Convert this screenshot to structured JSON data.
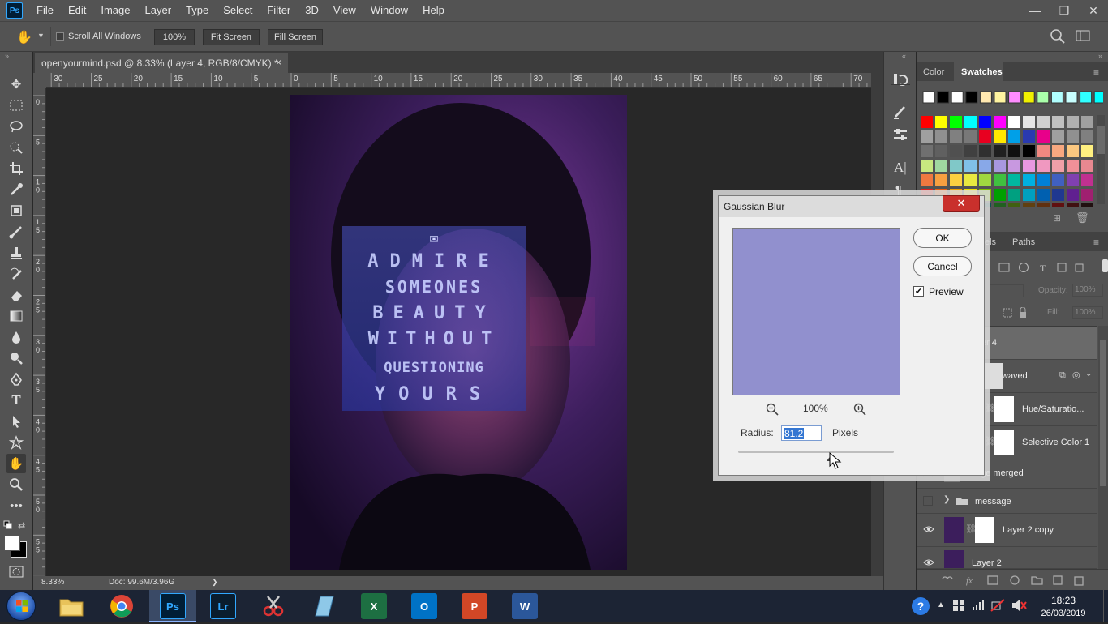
{
  "app": {
    "logo": "Ps"
  },
  "menu": [
    "File",
    "Edit",
    "Image",
    "Layer",
    "Type",
    "Select",
    "Filter",
    "3D",
    "View",
    "Window",
    "Help"
  ],
  "window_controls": {
    "min": "—",
    "max": "❐",
    "close": "✕"
  },
  "options": {
    "scroll_all_label": "Scroll All Windows",
    "zoom_btn": "100%",
    "fit_btn": "Fit Screen",
    "fill_btn": "Fill Screen"
  },
  "document": {
    "tab_title": "openyourmind.psd @ 8.33% (Layer 4, RGB/8/CMYK) *",
    "tab_close": "×"
  },
  "ruler_h": [
    "30",
    "25",
    "20",
    "15",
    "10",
    "5",
    "0",
    "5",
    "10",
    "15",
    "20",
    "25",
    "30",
    "35",
    "40",
    "45",
    "50",
    "55",
    "60",
    "65",
    "70"
  ],
  "ruler_v": [
    "0",
    "5",
    "1\n0",
    "1\n5",
    "2\n0",
    "2\n5",
    "3\n0",
    "3\n5",
    "4\n0",
    "4\n5",
    "5\n0",
    "5\n5"
  ],
  "status": {
    "zoom": "8.33%",
    "doc": "Doc: 99.6M/3.96G",
    "arrow": "❯"
  },
  "artwork_text": [
    "ADMIRE",
    "SOMEONES",
    "BEAUTY",
    "WITHOUT",
    "QUESTIONING",
    "YOURS"
  ],
  "dialog": {
    "title": "Gaussian Blur",
    "close": "✕",
    "ok": "OK",
    "cancel": "Cancel",
    "preview_label": "Preview",
    "preview_checked": true,
    "zoom": "100%",
    "radius_label": "Radius:",
    "radius_value": "81.2",
    "units": "Pixels",
    "preview_color": "#9190ce"
  },
  "color_panel": {
    "tab_color": "Color",
    "tab_swatches": "Swatches"
  },
  "layers_panel": {
    "tab_channels_partial": "els",
    "tab_paths": "Paths",
    "opacity_label": "Opacity:",
    "opacity_value": "100%",
    "fill_label": "Fill:",
    "fill_value": "100%",
    "layers": [
      {
        "name": "er 4"
      },
      {
        "name": "waved"
      },
      {
        "name": "Hue/Saturatio..."
      },
      {
        "name": "Selective Color 1"
      },
      {
        "name": "ssage merged"
      },
      {
        "name": "message"
      },
      {
        "name": "Layer 2 copy"
      },
      {
        "name": "Layer 2"
      }
    ]
  },
  "taskbar": {
    "time": "18:23",
    "date": "26/03/2019",
    "apps": [
      "Ps",
      "Lr",
      "X",
      "O",
      "P",
      "W"
    ]
  }
}
